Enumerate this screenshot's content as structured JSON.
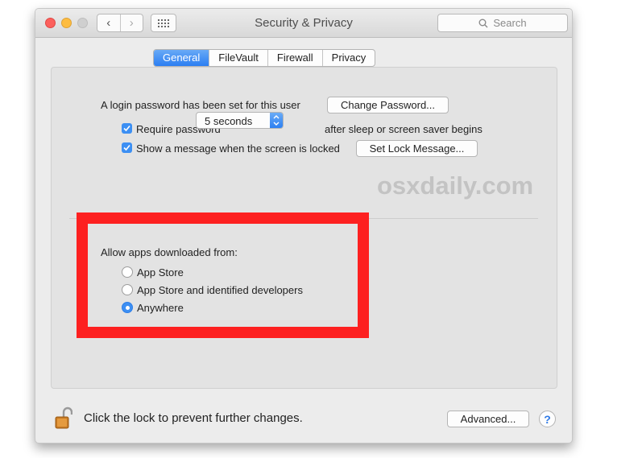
{
  "window": {
    "title": "Security & Privacy",
    "search_placeholder": "Search"
  },
  "tabs": [
    {
      "label": "General",
      "active": true
    },
    {
      "label": "FileVault",
      "active": false
    },
    {
      "label": "Firewall",
      "active": false
    },
    {
      "label": "Privacy",
      "active": false
    }
  ],
  "general": {
    "login_password_text": "A login password has been set for this user",
    "change_password_label": "Change Password...",
    "require_password": {
      "checked": true,
      "label": "Require password",
      "delay_value": "5 seconds",
      "suffix": "after sleep or screen saver begins"
    },
    "show_message": {
      "checked": true,
      "label": "Show a message when the screen is locked",
      "button_label": "Set Lock Message..."
    },
    "allow_apps": {
      "heading": "Allow apps downloaded from:",
      "options": [
        {
          "label": "App Store",
          "selected": false
        },
        {
          "label": "App Store and identified developers",
          "selected": false
        },
        {
          "label": "Anywhere",
          "selected": true
        }
      ]
    }
  },
  "footer": {
    "lock_message": "Click the lock to prevent further changes.",
    "advanced_label": "Advanced...",
    "help_label": "?"
  },
  "watermark": "osxdaily.com",
  "colors": {
    "accent": "#3c8ff3",
    "highlight_box": "#fd2020"
  }
}
